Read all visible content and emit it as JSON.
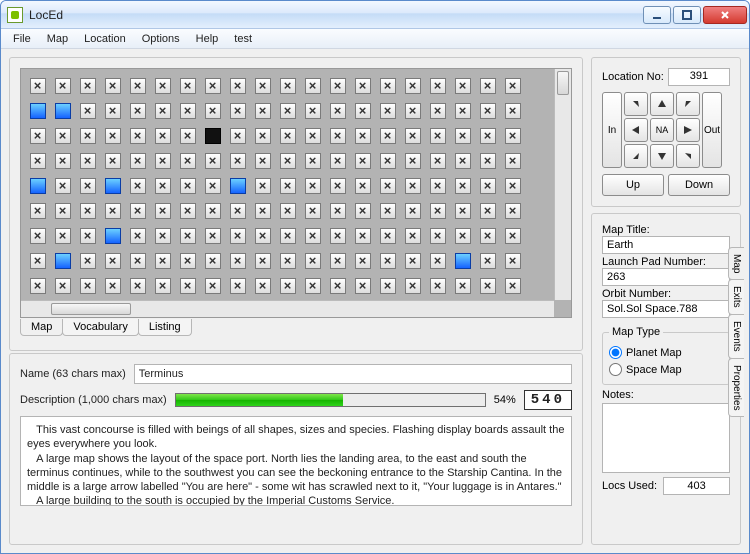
{
  "window": {
    "title": "LocEd"
  },
  "menu": [
    "File",
    "Map",
    "Location",
    "Options",
    "Help",
    "test"
  ],
  "left_tabs": [
    "Map",
    "Vocabulary",
    "Listing"
  ],
  "active_left_tab": 0,
  "loc": {
    "name_label": "Name (63 chars max)",
    "name_value": "Terminus",
    "desc_label": "Description (1,000 chars max)",
    "percent_text": "54%",
    "char_lcd": "540",
    "desc_text": "   This vast concourse is filled with beings of all shapes, sizes and species. Flashing display boards assault the eyes everywhere you look.\n   A large map shows the layout of the space port. North lies the landing area, to the east and south the terminus continues, while to the southwest you can see the beckoning entrance to the Starship Cantina. In the middle is a large arrow labelled \"You are here\" - some wit has scrawled next to it, \"Your luggage is in Antares.\"\n   A large building to the south is occupied by the Imperial Customs Service."
  },
  "right": {
    "loc_no_label": "Location No:",
    "loc_no_value": "391",
    "in_label": "In",
    "out_label": "Out",
    "na_label": "NA",
    "up_label": "Up",
    "down_label": "Down",
    "map_title_label": "Map Title:",
    "map_title_value": "Earth",
    "launch_label": "Launch Pad Number:",
    "launch_value": "263",
    "orbit_label": "Orbit Number:",
    "orbit_value": "Sol.Sol Space.788",
    "map_type_legend": "Map Type",
    "radio_planet": "Planet Map",
    "radio_space": "Space Map",
    "planet_selected": true,
    "notes_label": "Notes:",
    "notes_value": "",
    "locs_used_label": "Locs Used:",
    "locs_used_value": "403",
    "side_tabs": [
      "Map",
      "Exits",
      "Events",
      "Properties"
    ],
    "active_side_tab": 0
  },
  "grid": {
    "cols": 20,
    "rows": 9,
    "blue": [
      [
        0,
        1
      ],
      [
        1,
        1
      ],
      [
        0,
        4
      ],
      [
        3,
        4
      ],
      [
        8,
        4
      ],
      [
        17,
        7
      ],
      [
        3,
        6
      ],
      [
        1,
        7
      ]
    ],
    "black": [
      [
        7,
        2
      ]
    ]
  }
}
